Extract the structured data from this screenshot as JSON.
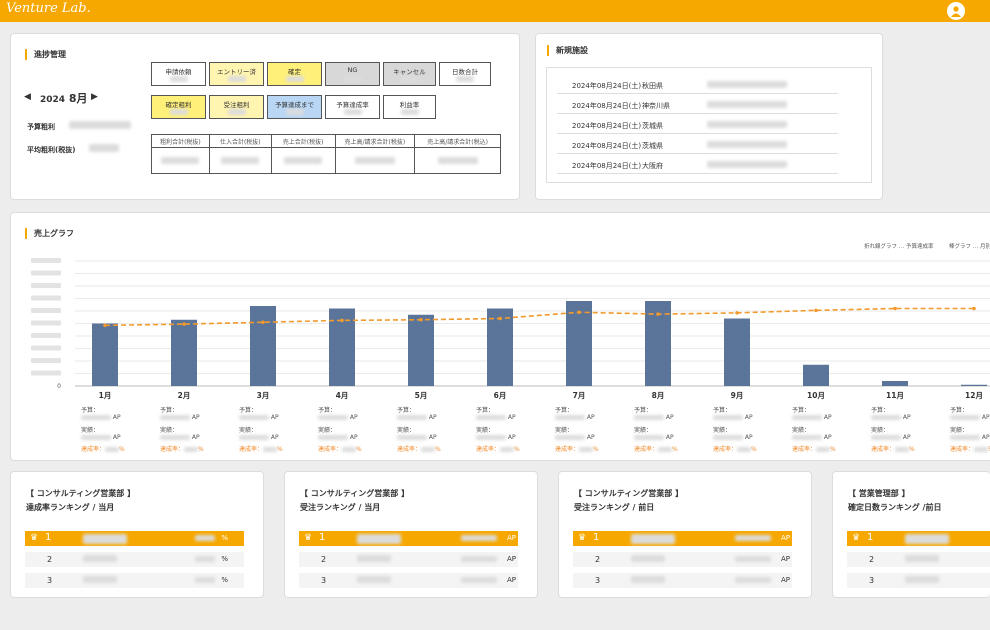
{
  "app": {
    "logo": "Venture Lab."
  },
  "progress": {
    "title": "進捗管理",
    "year": "2024",
    "month": "8月",
    "budget_label": "予算粗利",
    "avg_label": "平均粗利(税抜)",
    "status_row1": [
      "申請依頼",
      "エントリー済",
      "確定",
      "NG",
      "キャンセル",
      "日数合計"
    ],
    "status_row2": [
      "確定粗利",
      "受注粗利",
      "予算達成まで",
      "予算達成率",
      "利益率"
    ],
    "finance_headers": [
      "粗利合計(税抜)",
      "仕入合計(税抜)",
      "売上合計(税抜)",
      "売上高/請求合計(税抜)",
      "売上高/請求合計(税込)"
    ]
  },
  "facility": {
    "title": "新規施設",
    "rows": [
      {
        "date": "2024年08月24日(土)",
        "pref": "秋田県"
      },
      {
        "date": "2024年08月24日(土)",
        "pref": "神奈川県"
      },
      {
        "date": "2024年08月24日(土)",
        "pref": "茨城県"
      },
      {
        "date": "2024年08月24日(土)",
        "pref": "茨城県"
      },
      {
        "date": "2024年08月24日(土)",
        "pref": "大阪府"
      }
    ]
  },
  "sales": {
    "title": "売上グラフ",
    "legend_line": "折れ線グラフ … 予算達成率",
    "legend_bar": "棒グラフ … 月別",
    "budget_label": "予算：",
    "actual_label": "実績：",
    "rate_label": "達成率：",
    "unit": "AP",
    "percent": "%"
  },
  "chart_data": {
    "type": "bar",
    "categories": [
      "1月",
      "2月",
      "3月",
      "4月",
      "5月",
      "6月",
      "7月",
      "8月",
      "9月",
      "10月",
      "11月",
      "12月"
    ],
    "series": [
      {
        "type": "bar",
        "values": [
          50,
          53,
          64,
          62,
          57,
          62,
          68,
          68,
          54,
          17,
          4,
          1
        ],
        "color": "#5b749a"
      },
      {
        "type": "line",
        "values": [
          48.5,
          49.5,
          51,
          52.5,
          53,
          54,
          59,
          57.5,
          58.5,
          60.5,
          62,
          62
        ],
        "color": "#f39a2d"
      }
    ],
    "ylim": [
      0,
      100
    ],
    "grid": true,
    "legend": "top-right"
  },
  "rankings": [
    {
      "dept": "【 コンサルティング営業部 】",
      "title": "達成率ランキング / 当月",
      "unit": "%",
      "ranks": [
        "1",
        "2",
        "3"
      ]
    },
    {
      "dept": "【 コンサルティング営業部 】",
      "title": "受注ランキング / 当月",
      "unit": "AP",
      "ranks": [
        "1",
        "2",
        "3"
      ]
    },
    {
      "dept": "【 コンサルティング営業部 】",
      "title": "受注ランキング / 前日",
      "unit": "AP",
      "ranks": [
        "1",
        "2",
        "3"
      ]
    },
    {
      "dept": "【 営業管理部 】",
      "title": "確定日数ランキング /前日",
      "unit": "",
      "ranks": [
        "1",
        "2",
        "3"
      ]
    }
  ],
  "colors": {
    "accent": "#f6a800",
    "bar": "#5b749a",
    "line": "#f39a2d",
    "yellow": "#fff07a",
    "light_yellow": "#fff4b0",
    "blue": "#b9d6f4",
    "gray": "#d8d8d8"
  }
}
